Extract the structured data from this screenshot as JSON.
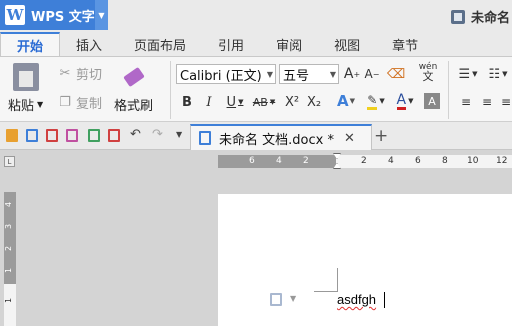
{
  "app": {
    "name": "WPS 文字",
    "logo": "W",
    "window_title": "未命名"
  },
  "ribbon_tabs": [
    "开始",
    "插入",
    "页面布局",
    "引用",
    "审阅",
    "视图",
    "章节"
  ],
  "clipboard": {
    "paste": "粘贴",
    "cut": "剪切",
    "copy": "复制",
    "format_painter": "格式刷"
  },
  "font": {
    "name": "Calibri (正文)",
    "size": "五号"
  },
  "font_buttons": {
    "bold": "B",
    "italic": "I",
    "underline": "U",
    "strike": "AB",
    "superscript": "X²",
    "subscript": "X₂",
    "grow": "A",
    "shrink": "A",
    "phonetic": "wén"
  },
  "doc_tab": {
    "name": "未命名 文档.docx *"
  },
  "ruler": {
    "h_numbers": [
      "6",
      "4",
      "2",
      "2",
      "4",
      "6",
      "8",
      "10",
      "12"
    ],
    "v_numbers": [
      "4",
      "3",
      "2",
      "1",
      "1"
    ]
  },
  "document": {
    "text": "asdfgh"
  },
  "colors": {
    "accent": "#3e7fd8",
    "highlight": "#f0d020",
    "font_color": "#d02020"
  }
}
